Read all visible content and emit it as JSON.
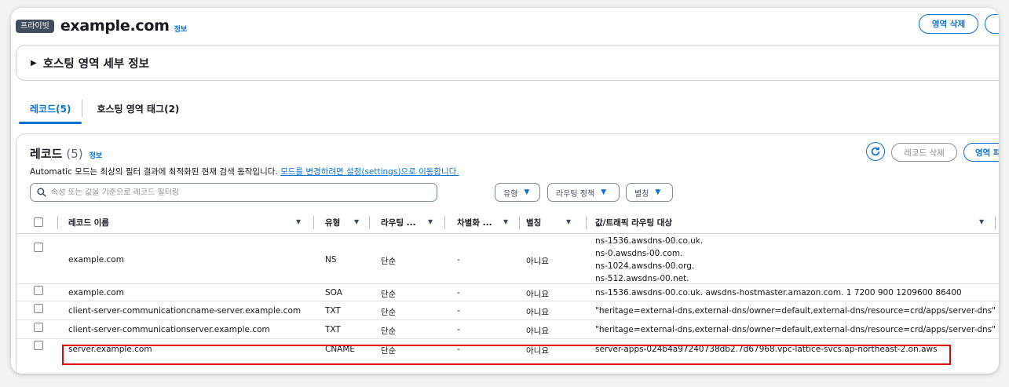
{
  "header": {
    "badge": "프라이빗",
    "zone_name": "example.com",
    "info": "정보",
    "delete_zone_button": "영역 삭제"
  },
  "details": {
    "title": "호스팅 영역 세부 정보"
  },
  "tabs": [
    {
      "label": "레코드(5)",
      "active": true
    },
    {
      "label": "호스팅 영역 태그(2)",
      "active": false
    }
  ],
  "records": {
    "title": "레코드",
    "count": "(5)",
    "info": "정보",
    "auto_note_text": "Automatic 모드는 최상의 필터 결과에 최적화된 현재 검색 동작입니다.",
    "auto_note_link": "모드를 변경하려면 설정(settings)으로 이동합니다.",
    "delete_record_button": "레코드 삭제",
    "import_button": "영역 파",
    "search_placeholder": "속성 또는 값을 기준으로 레코드 필터링",
    "filters": {
      "type": "유형",
      "routing_policy": "라우팅 정책",
      "alias": "별칭"
    },
    "columns": {
      "name": "레코드 이름",
      "type": "유형",
      "routing": "라우팅 ...",
      "differentiator": "차별화 ...",
      "alias": "별칭",
      "value": "값/트래픽 라우팅 대상"
    },
    "rows": [
      {
        "name": "example.com",
        "type": "NS",
        "routing": "단순",
        "diff": "-",
        "alias": "아니요",
        "value_lines": [
          "ns-1536.awsdns-00.co.uk.",
          "ns-0.awsdns-00.com.",
          "ns-1024.awsdns-00.org.",
          "ns-512.awsdns-00.net."
        ]
      },
      {
        "name": "example.com",
        "type": "SOA",
        "routing": "단순",
        "diff": "-",
        "alias": "아니요",
        "value": "ns-1536.awsdns-00.co.uk. awsdns-hostmaster.amazon.com. 1 7200 900 1209600 86400"
      },
      {
        "name": "client-server-communicationcname-server.example.com",
        "type": "TXT",
        "routing": "단순",
        "diff": "-",
        "alias": "아니요",
        "value": "\"heritage=external-dns,external-dns/owner=default,external-dns/resource=crd/apps/server-dns\""
      },
      {
        "name": "client-server-communicationserver.example.com",
        "type": "TXT",
        "routing": "단순",
        "diff": "-",
        "alias": "아니요",
        "value": "\"heritage=external-dns,external-dns/owner=default,external-dns/resource=crd/apps/server-dns\""
      },
      {
        "name": "server.example.com",
        "type": "CNAME",
        "routing": "단순",
        "diff": "-",
        "alias": "아니요",
        "value": "server-apps-024b4a97240738db2.7d67968.vpc-lattice-svcs.ap-northeast-2.on.aws"
      }
    ]
  },
  "colors": {
    "accent": "#0972d3",
    "highlight": "#e0000b",
    "badge_bg": "#414d5c"
  }
}
